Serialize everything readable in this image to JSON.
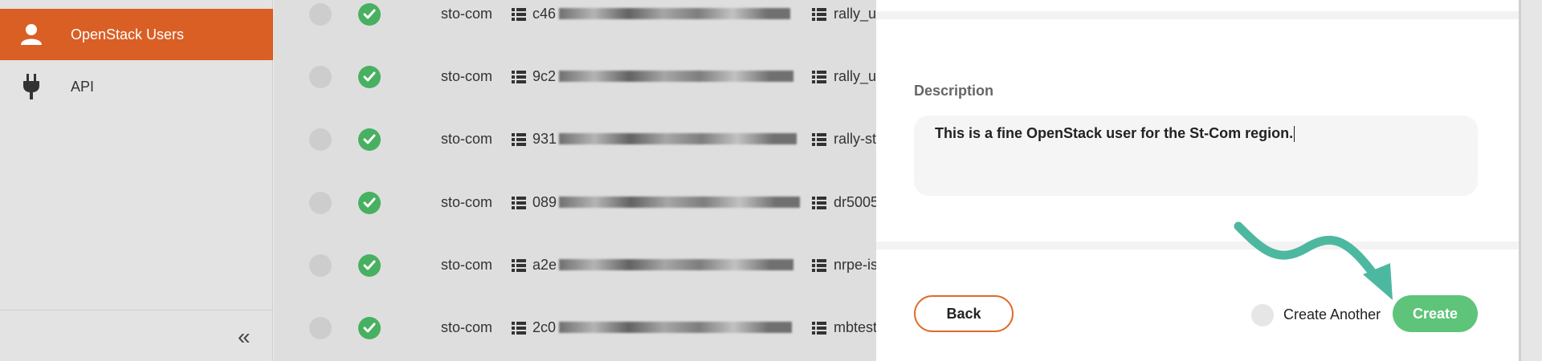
{
  "sidebar": {
    "items": [
      {
        "label": "OpenStack Users",
        "icon": "user-icon"
      },
      {
        "label": "API",
        "icon": "plug-icon"
      }
    ],
    "collapse_label": "«"
  },
  "table": {
    "rows": [
      {
        "region": "sto-com",
        "id": "c46",
        "name": "rally_u"
      },
      {
        "region": "sto-com",
        "id": "9c2",
        "name": "rally_u"
      },
      {
        "region": "sto-com",
        "id": "931",
        "name": "rally-st"
      },
      {
        "region": "sto-com",
        "id": "089",
        "name": "dr5005"
      },
      {
        "region": "sto-com",
        "id": "a2e",
        "name": "nrpe-is"
      },
      {
        "region": "sto-com",
        "id": "2c0",
        "name": "mbtest"
      }
    ]
  },
  "panel": {
    "description_label": "Description",
    "description_value": "This is a fine OpenStack user for the St-Com region.",
    "back_label": "Back",
    "create_another_label": "Create Another",
    "create_label": "Create"
  },
  "colors": {
    "accent": "#d95f25",
    "success": "#48b061",
    "create": "#5ec47a",
    "arrow": "#4db8a0"
  }
}
